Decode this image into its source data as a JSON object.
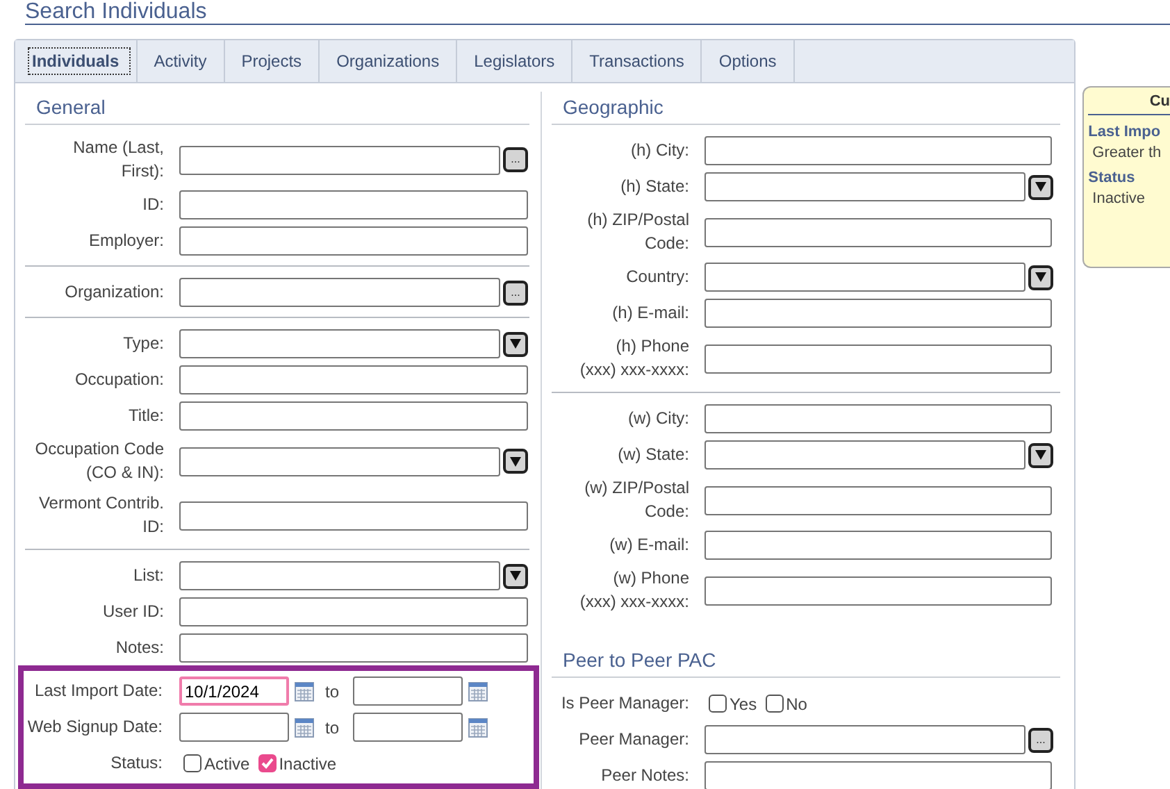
{
  "page_title": "Search Individuals",
  "tabs": [
    {
      "label": "Individuals",
      "selected": true
    },
    {
      "label": "Activity",
      "selected": false
    },
    {
      "label": "Projects",
      "selected": false
    },
    {
      "label": "Organizations",
      "selected": false
    },
    {
      "label": "Legislators",
      "selected": false
    },
    {
      "label": "Transactions",
      "selected": false
    },
    {
      "label": "Options",
      "selected": false
    }
  ],
  "columns": [
    {
      "sections": [
        {
          "heading": "General",
          "groups": [
            {
              "highlighted": false,
              "rows": [
                {
                  "kind": "lookup",
                  "label": "Name (Last, First):",
                  "button": "..."
                },
                {
                  "kind": "text",
                  "label": "ID:"
                },
                {
                  "kind": "text",
                  "label": "Employer:"
                }
              ]
            },
            {
              "highlighted": false,
              "rows": [
                {
                  "kind": "lookup",
                  "label": "Organization:",
                  "button": "..."
                }
              ]
            },
            {
              "highlighted": false,
              "rows": [
                {
                  "kind": "select",
                  "label": "Type:"
                },
                {
                  "kind": "text",
                  "label": "Occupation:"
                },
                {
                  "kind": "text",
                  "label": "Title:"
                },
                {
                  "kind": "select",
                  "label": "Occupation Code (CO & IN):"
                },
                {
                  "kind": "text",
                  "label": "Vermont Contrib. ID:"
                }
              ]
            },
            {
              "highlighted": false,
              "rows": [
                {
                  "kind": "select",
                  "label": "List:"
                },
                {
                  "kind": "text",
                  "label": "User ID:"
                },
                {
                  "kind": "text",
                  "label": "Notes:"
                }
              ]
            },
            {
              "highlighted": true,
              "rows": [
                {
                  "kind": "daterange",
                  "label": "Last Import Date:",
                  "from": "10/1/2024",
                  "from_focused": true,
                  "to_label": "to"
                },
                {
                  "kind": "daterange",
                  "label": "Web Signup Date:",
                  "from_focused": false,
                  "to_label": "to"
                },
                {
                  "kind": "checks",
                  "label": "Status:",
                  "options": [
                    {
                      "label": "Active",
                      "checked": false
                    },
                    {
                      "label": "Inactive",
                      "checked": true
                    }
                  ]
                }
              ]
            }
          ]
        }
      ]
    },
    {
      "sections": [
        {
          "heading": "Geographic",
          "groups": [
            {
              "highlighted": false,
              "rows": [
                {
                  "kind": "text",
                  "label": "(h) City:"
                },
                {
                  "kind": "select",
                  "label": "(h) State:"
                },
                {
                  "kind": "text",
                  "label": "(h) ZIP/Postal Code:"
                },
                {
                  "kind": "select",
                  "label": "Country:"
                },
                {
                  "kind": "text",
                  "label": "(h) E-mail:"
                },
                {
                  "kind": "text",
                  "label": "(h) Phone (xxx) xxx-xxxx:"
                }
              ]
            },
            {
              "highlighted": false,
              "rows": [
                {
                  "kind": "text",
                  "label": "(w) City:"
                },
                {
                  "kind": "select",
                  "label": "(w) State:"
                },
                {
                  "kind": "text",
                  "label": "(w) ZIP/Postal Code:"
                },
                {
                  "kind": "text",
                  "label": "(w) E-mail:"
                },
                {
                  "kind": "text",
                  "label": "(w) Phone (xxx) xxx-xxxx:"
                }
              ]
            }
          ]
        },
        {
          "heading": "Peer to Peer PAC",
          "groups": [
            {
              "highlighted": false,
              "rows": [
                {
                  "kind": "checks",
                  "label": "Is Peer Manager:",
                  "options": [
                    {
                      "label": "Yes",
                      "checked": false
                    },
                    {
                      "label": "No",
                      "checked": false
                    }
                  ]
                },
                {
                  "kind": "lookup",
                  "label": "Peer Manager:",
                  "button": "..."
                },
                {
                  "kind": "text",
                  "label": "Peer Notes:"
                }
              ]
            }
          ]
        }
      ]
    }
  ],
  "criteria_card": {
    "title": "Cu",
    "items": [
      {
        "heading": "Last Impo",
        "value": "Greater th"
      },
      {
        "heading": "Status",
        "value": "Inactive"
      }
    ]
  }
}
